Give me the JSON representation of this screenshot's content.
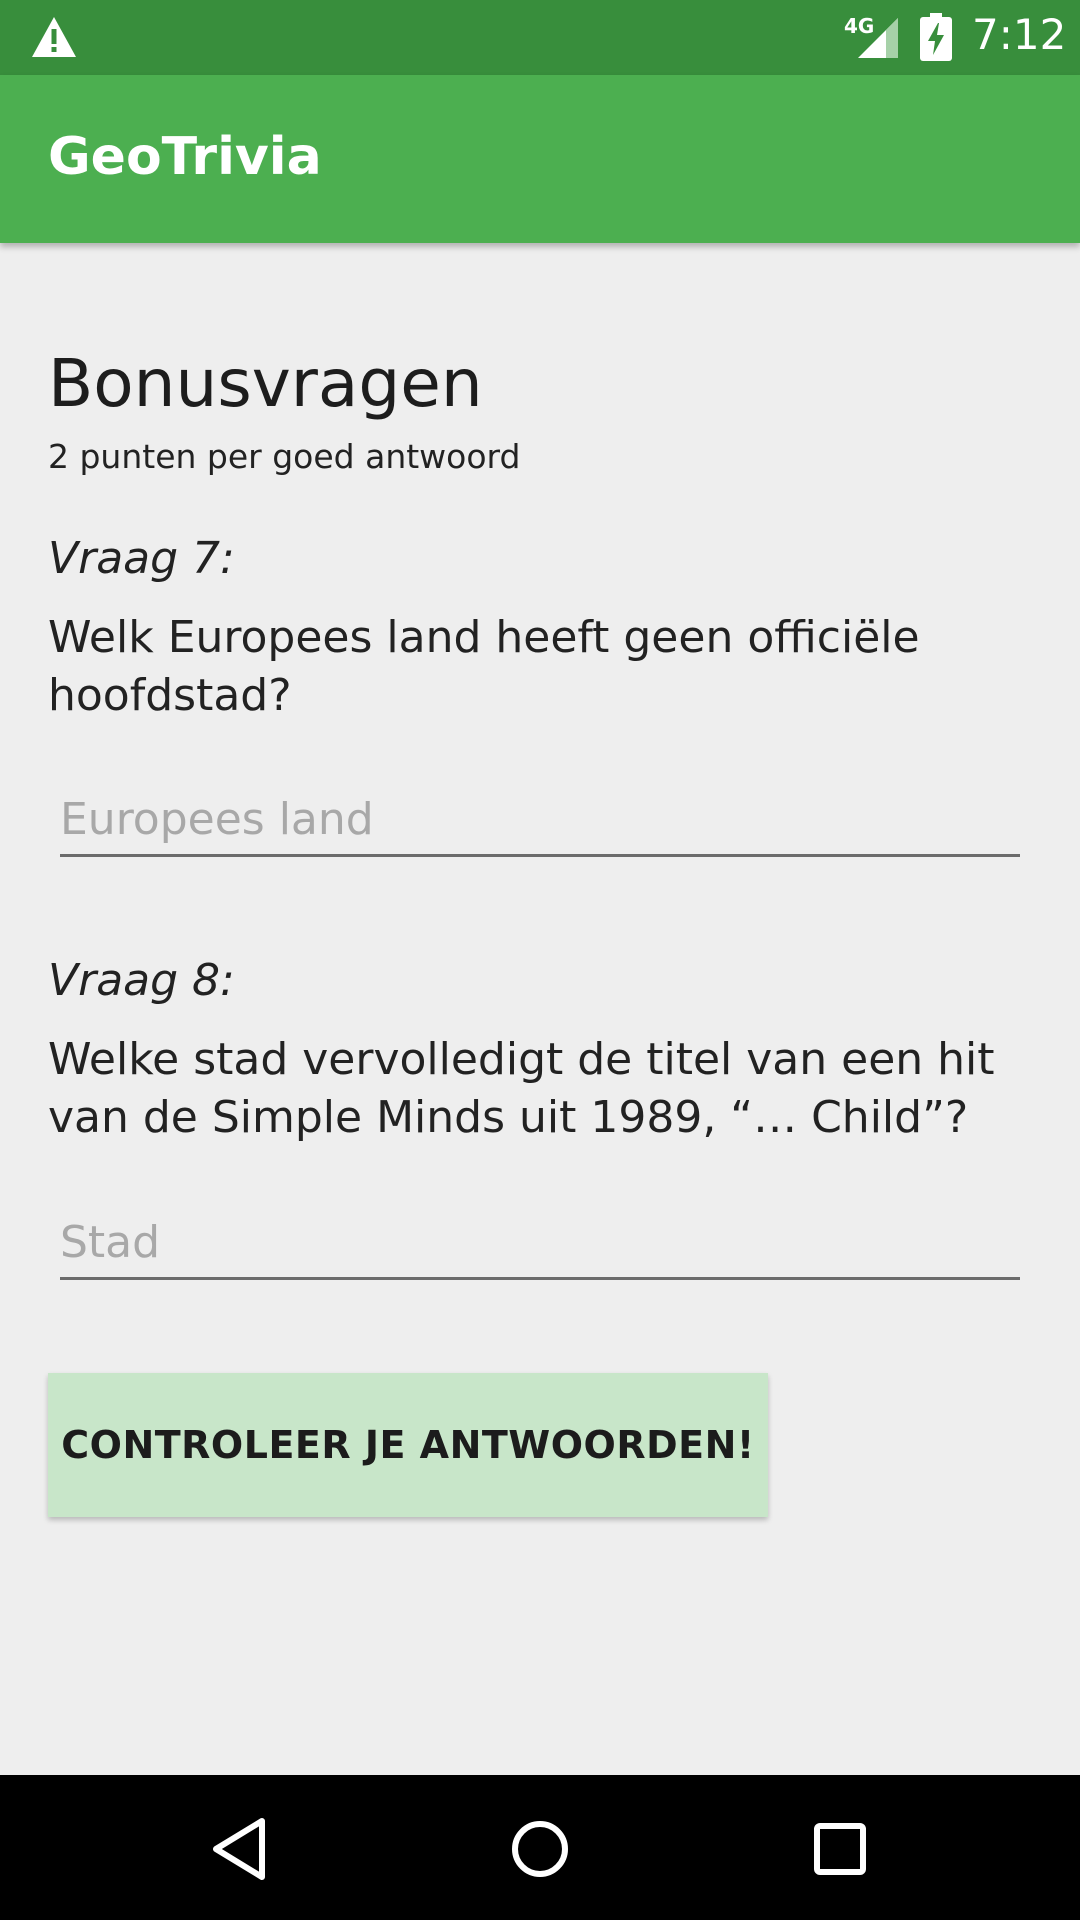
{
  "status_bar": {
    "time": "7:12",
    "network_label": "4G",
    "icons": [
      "warning-icon",
      "signal-icon",
      "battery-charging-icon"
    ]
  },
  "app_bar": {
    "title": "GeoTrivia"
  },
  "bonus": {
    "title": "Bonusvragen",
    "subtitle": "2 punten per goed antwoord"
  },
  "questions": [
    {
      "label": "Vraag 7:",
      "text": "Welk Europees land heeft geen officiële hoofdstad?",
      "placeholder": "Europees land",
      "value": ""
    },
    {
      "label": "Vraag 8:",
      "text": "Welke stad vervolledigt de titel van een hit van de Simple Minds uit 1989, “… Child”?",
      "placeholder": "Stad",
      "value": ""
    }
  ],
  "check_button": {
    "label": "CONTROLEER JE ANTWOORDEN!"
  },
  "colors": {
    "status_bar": "#388e3c",
    "app_bar": "#4caf50",
    "button": "#c8e6c9",
    "background": "#eeeeee"
  },
  "navigation": {
    "icons": [
      "back-icon",
      "home-icon",
      "recents-icon"
    ]
  }
}
